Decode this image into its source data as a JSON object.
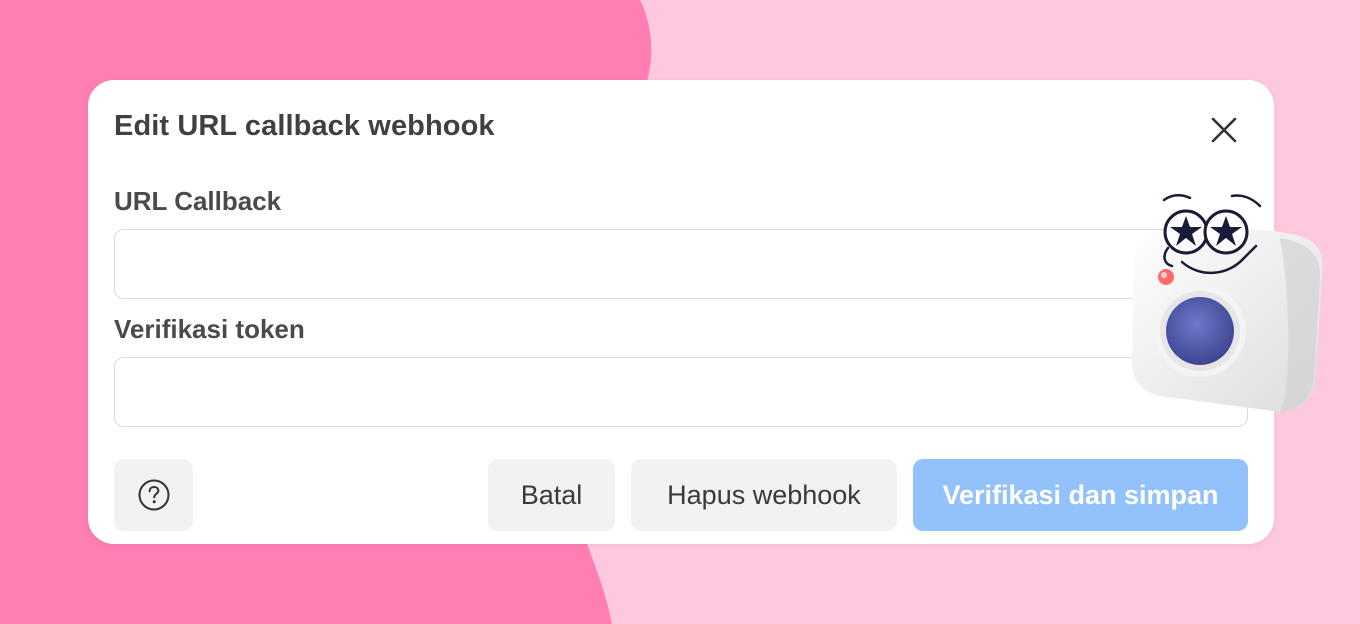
{
  "dialog": {
    "title": "Edit URL callback webhook"
  },
  "form": {
    "callback_label": "URL Callback",
    "callback_value": "",
    "token_label": "Verifikasi token",
    "token_value": ""
  },
  "actions": {
    "cancel_label": "Batal",
    "delete_label": "Hapus webhook",
    "save_label": "Verifikasi dan simpan"
  },
  "icons": {
    "close": "close-icon",
    "help": "help-circle-icon",
    "mascot": "camera-mascot-icon"
  },
  "colors": {
    "background_light": "#fec8de",
    "background_blob": "#ff7fb5",
    "primary_disabled": "#92c1fb",
    "secondary_button": "#f2f2f2"
  }
}
